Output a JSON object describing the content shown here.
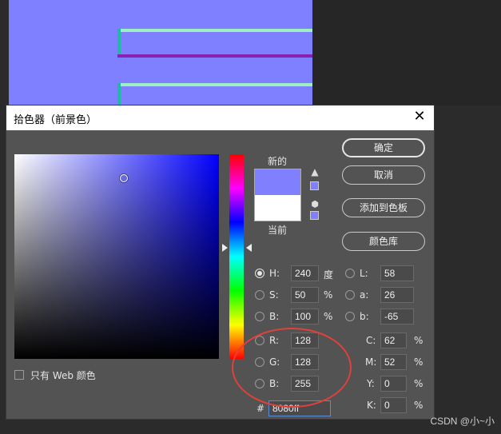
{
  "dialog": {
    "title": "拾色器（前景色）",
    "close_glyph": "✕"
  },
  "preview": {
    "new_label": "新的",
    "current_label": "当前",
    "new_color": "#8080ff",
    "current_color": "#ffffff"
  },
  "buttons": {
    "ok": "确定",
    "cancel": "取消",
    "add_to_swatches": "添加到色板",
    "color_libraries": "颜色库"
  },
  "only_web_colors": "只有 Web 颜色",
  "hsb": {
    "h_label": "H:",
    "h_value": "240",
    "h_unit": "度",
    "s_label": "S:",
    "s_value": "50",
    "s_unit": "%",
    "b_label": "B:",
    "b_value": "100",
    "b_unit": "%"
  },
  "rgb": {
    "r_label": "R:",
    "r_value": "128",
    "g_label": "G:",
    "g_value": "128",
    "b_label": "B:",
    "b_value": "255"
  },
  "lab": {
    "l_label": "L:",
    "l_value": "58",
    "a_label": "a:",
    "a_value": "26",
    "b_label": "b:",
    "b_value": "-65"
  },
  "cmyk": {
    "c_label": "C:",
    "c_value": "62",
    "c_unit": "%",
    "m_label": "M:",
    "m_value": "52",
    "m_unit": "%",
    "y_label": "Y:",
    "y_value": "0",
    "y_unit": "%",
    "k_label": "K:",
    "k_value": "0",
    "k_unit": "%"
  },
  "hex": {
    "label": "#",
    "value": "8080ff"
  },
  "watermark": "CSDN @小~小",
  "icons": {
    "warning": "gamut-warning-icon",
    "cube": "web-safe-cube-icon"
  }
}
